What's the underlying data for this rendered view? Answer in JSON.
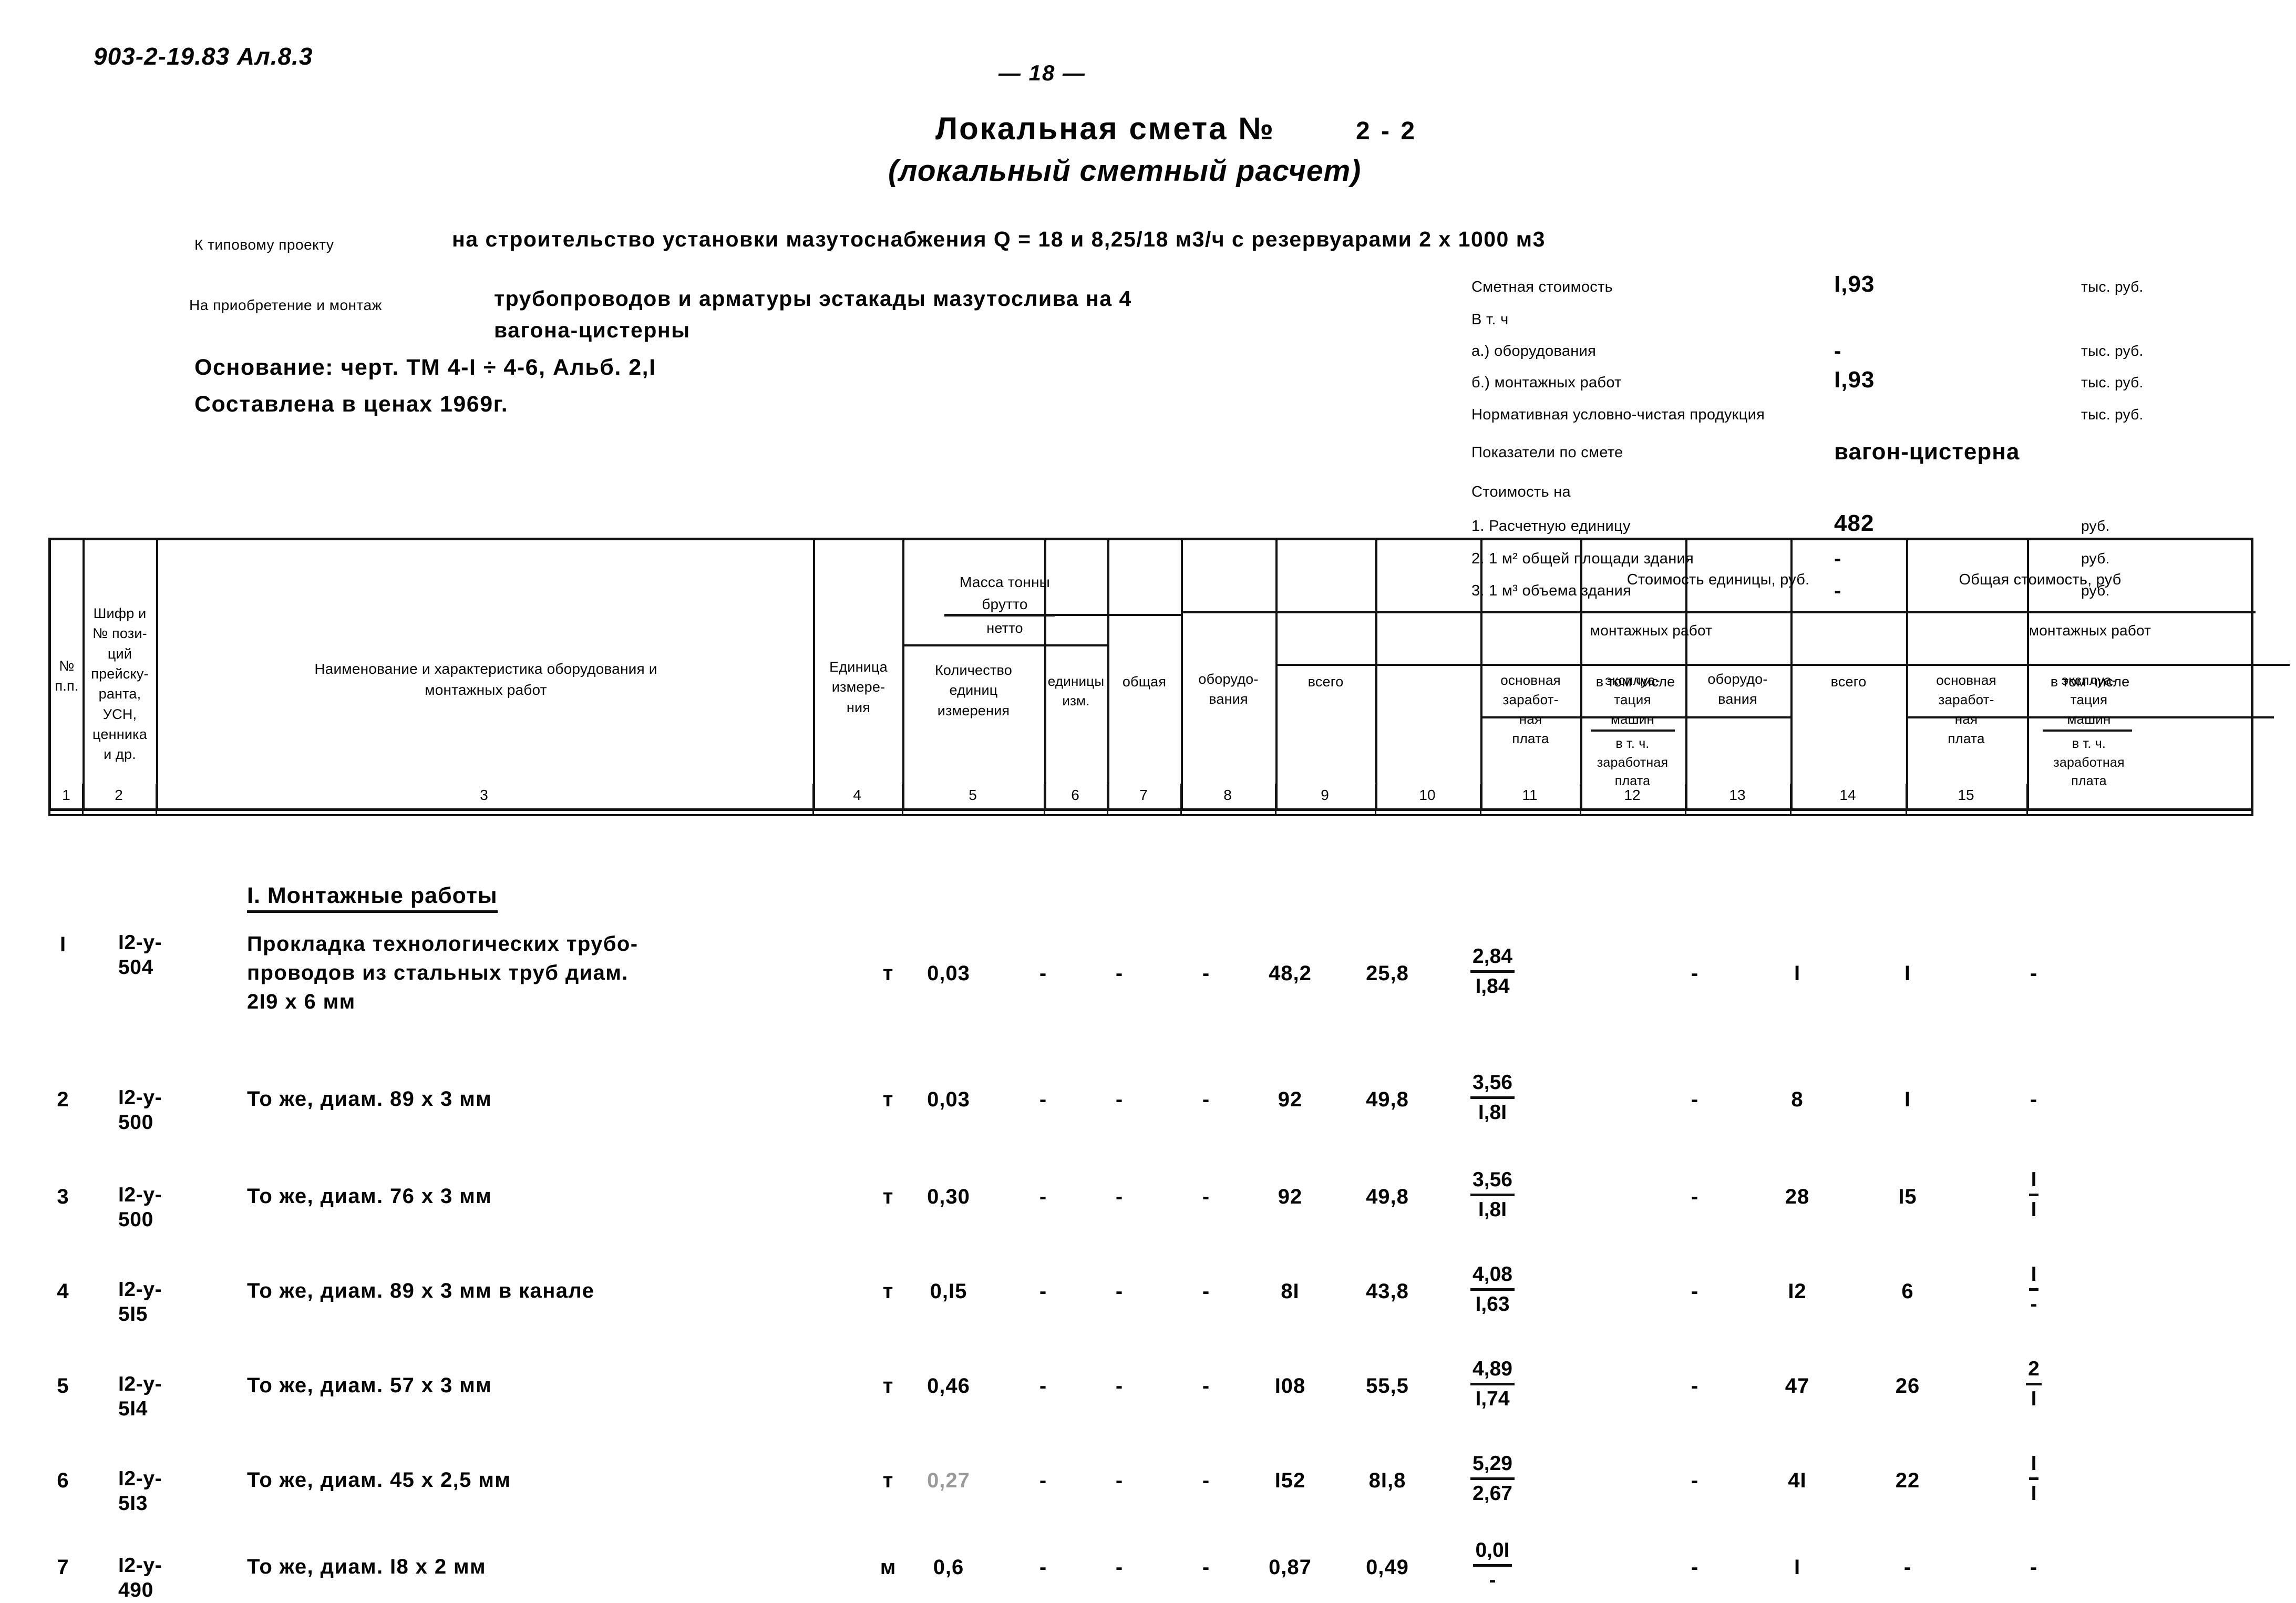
{
  "document": {
    "code": "903-2-19.83 Ал.8.3",
    "page_number": "— 18 —",
    "title": "Локальная смета №",
    "title_number": "2 - 2",
    "title_sub": "(локальный сметный расчет)"
  },
  "intro": {
    "label_typical_project": "К типовому проекту",
    "text_typical_project": "на строительство установки мазутоснабжения Q = 18 и 8,25/18 м3/ч с резервуарами 2 х 1000 м3",
    "label_purchase_install": "На приобретение и монтаж",
    "text_purchase_install_1": "трубопроводов  и арматуры эстакады мазутослива на 4",
    "text_purchase_install_2": "вагона-цистерны",
    "basis": "Основание: черт. ТМ 4-I ÷ 4-6,  Альб. 2,I",
    "prices": "Составлена в ценах 1969г."
  },
  "summary": {
    "rows": [
      {
        "label": "Сметная стоимость",
        "value": "I,93",
        "unit": "тыс. руб."
      },
      {
        "label": "В т. ч",
        "value": "",
        "unit": ""
      },
      {
        "label": "а.) оборудования",
        "value": "-",
        "unit": "тыс. руб."
      },
      {
        "label": "б.) монтажных работ",
        "value": "I,93",
        "unit": "тыс. руб."
      },
      {
        "label": "Нормативная условно-чистая продукция",
        "value": "",
        "unit": "тыс. руб."
      },
      {
        "label": "Показатели по смете",
        "value": "вагон-цистерна",
        "unit": ""
      },
      {
        "label": "Стоимость на",
        "value": "",
        "unit": ""
      },
      {
        "label": "1. Расчетную единицу",
        "value": "482",
        "unit": "руб."
      },
      {
        "label": "2. 1 м² общей площади здания",
        "value": "-",
        "unit": "руб."
      },
      {
        "label": "3. 1 м³ объема здания",
        "value": "-",
        "unit": "руб."
      }
    ]
  },
  "table": {
    "headers": {
      "col1": "№\nп.п.",
      "col2": "Шифр и\n№ пози-\nций\nпрейску-\nранта,\nУСН,\nценника\nи др.",
      "col3": "Наименование и характеристика оборудования и\nмонтажных работ",
      "col4": "Единица\nизмере-\nния",
      "col5": "Количество\nединиц\nизмерения",
      "mass_group": "Масса тонны",
      "mass_brutto": "брутто",
      "mass_netto": "нетто",
      "col6": "единицы\nизм.",
      "col7": "общая",
      "unit_cost_group": "Стоимость единицы, руб.",
      "col8": "оборудо-\nвания",
      "install_group": "монтажных работ",
      "col9": "всего",
      "in_which": "в том числе",
      "col10": "основная\nзаработ-\nная\nплата",
      "col11_a": "эксплуа-\nтация\nмашин",
      "col11_b": "в т. ч.\nзаработная\nплата",
      "total_cost_group": "Общая стоимость, руб",
      "col12": "оборудо-\nвания",
      "col13": "всего",
      "col14": "основная\nзаработ-\nная\nплата",
      "col15_a": "эксплуа-\nтация\nмашин",
      "col15_b": "в т. ч.\nзаработная\nплата"
    },
    "column_numbers": [
      "1",
      "2",
      "3",
      "4",
      "5",
      "6",
      "7",
      "8",
      "9",
      "10",
      "11",
      "12",
      "13",
      "14",
      "15"
    ],
    "section_heading": "I. Монтажные работы",
    "rows": [
      {
        "no": "I",
        "code_line1": "I2-у-",
        "code_line2": "504",
        "desc": "Прокладка технологических трубо-\nпроводов из стальных труб диам.\n2I9 х 6 мм",
        "unit": "т",
        "qty": "0,03",
        "mass_unit": "-",
        "mass_total": "-",
        "uc_equip": "-",
        "uc_total": "48,2",
        "uc_wage": "25,8",
        "uc_mach_top": "2,84",
        "uc_mach_bot": "I,84",
        "tc_equip": "-",
        "tc_total": "I",
        "tc_wage": "I",
        "tc_mach_top": "-",
        "tc_mach_bot": ""
      },
      {
        "no": "2",
        "code_line1": "I2-у-",
        "code_line2": "500",
        "desc": "То же, диам. 89 х 3 мм",
        "unit": "т",
        "qty": "0,03",
        "mass_unit": "-",
        "mass_total": "-",
        "uc_equip": "-",
        "uc_total": "92",
        "uc_wage": "49,8",
        "uc_mach_top": "3,56",
        "uc_mach_bot": "I,8I",
        "tc_equip": "-",
        "tc_total": "8",
        "tc_wage": "I",
        "tc_mach_top": "-",
        "tc_mach_bot": ""
      },
      {
        "no": "3",
        "code_line1": "I2-у-",
        "code_line2": "500",
        "desc": "То же, диам. 76 х 3 мм",
        "unit": "т",
        "qty": "0,30",
        "mass_unit": "-",
        "mass_total": "-",
        "uc_equip": "-",
        "uc_total": "92",
        "uc_wage": "49,8",
        "uc_mach_top": "3,56",
        "uc_mach_bot": "I,8I",
        "tc_equip": "-",
        "tc_total": "28",
        "tc_wage": "I5",
        "tc_mach_top": "I",
        "tc_mach_bot": "I"
      },
      {
        "no": "4",
        "code_line1": "I2-у-",
        "code_line2": "5I5",
        "desc": "То же, диам. 89 х 3 мм в канале",
        "unit": "т",
        "qty": "0,I5",
        "mass_unit": "-",
        "mass_total": "-",
        "uc_equip": "-",
        "uc_total": "8I",
        "uc_wage": "43,8",
        "uc_mach_top": "4,08",
        "uc_mach_bot": "I,63",
        "tc_equip": "-",
        "tc_total": "I2",
        "tc_wage": "6",
        "tc_mach_top": "I",
        "tc_mach_bot": "-"
      },
      {
        "no": "5",
        "code_line1": "I2-у-",
        "code_line2": "5I4",
        "desc": "То же, диам. 57 х 3 мм",
        "unit": "т",
        "qty": "0,46",
        "mass_unit": "-",
        "mass_total": "-",
        "uc_equip": "-",
        "uc_total": "I08",
        "uc_wage": "55,5",
        "uc_mach_top": "4,89",
        "uc_mach_bot": "I,74",
        "tc_equip": "-",
        "tc_total": "47",
        "tc_wage": "26",
        "tc_mach_top": "2",
        "tc_mach_bot": "I"
      },
      {
        "no": "6",
        "code_line1": "I2-у-",
        "code_line2": "5I3",
        "desc": "То же, диам. 45 х 2,5 мм",
        "unit": "т",
        "qty": "0,27",
        "qty_faint": true,
        "mass_unit": "-",
        "mass_total": "-",
        "uc_equip": "-",
        "uc_total": "I52",
        "uc_wage": "8I,8",
        "uc_mach_top": "5,29",
        "uc_mach_bot": "2,67",
        "tc_equip": "-",
        "tc_total": "4I",
        "tc_wage": "22",
        "tc_mach_top": "I",
        "tc_mach_bot": "I"
      },
      {
        "no": "7",
        "code_line1": "I2-у-",
        "code_line2": "490",
        "desc": "То же, диам. I8 х 2 мм",
        "unit": "м",
        "qty": "0,6",
        "mass_unit": "-",
        "mass_total": "-",
        "uc_equip": "-",
        "uc_total": "0,87",
        "uc_wage": "0,49",
        "uc_mach_top": "0,0I",
        "uc_mach_bot": "-",
        "tc_equip": "-",
        "tc_total": "I",
        "tc_wage": "-",
        "tc_mach_top": "-",
        "tc_mach_bot": ""
      }
    ]
  }
}
